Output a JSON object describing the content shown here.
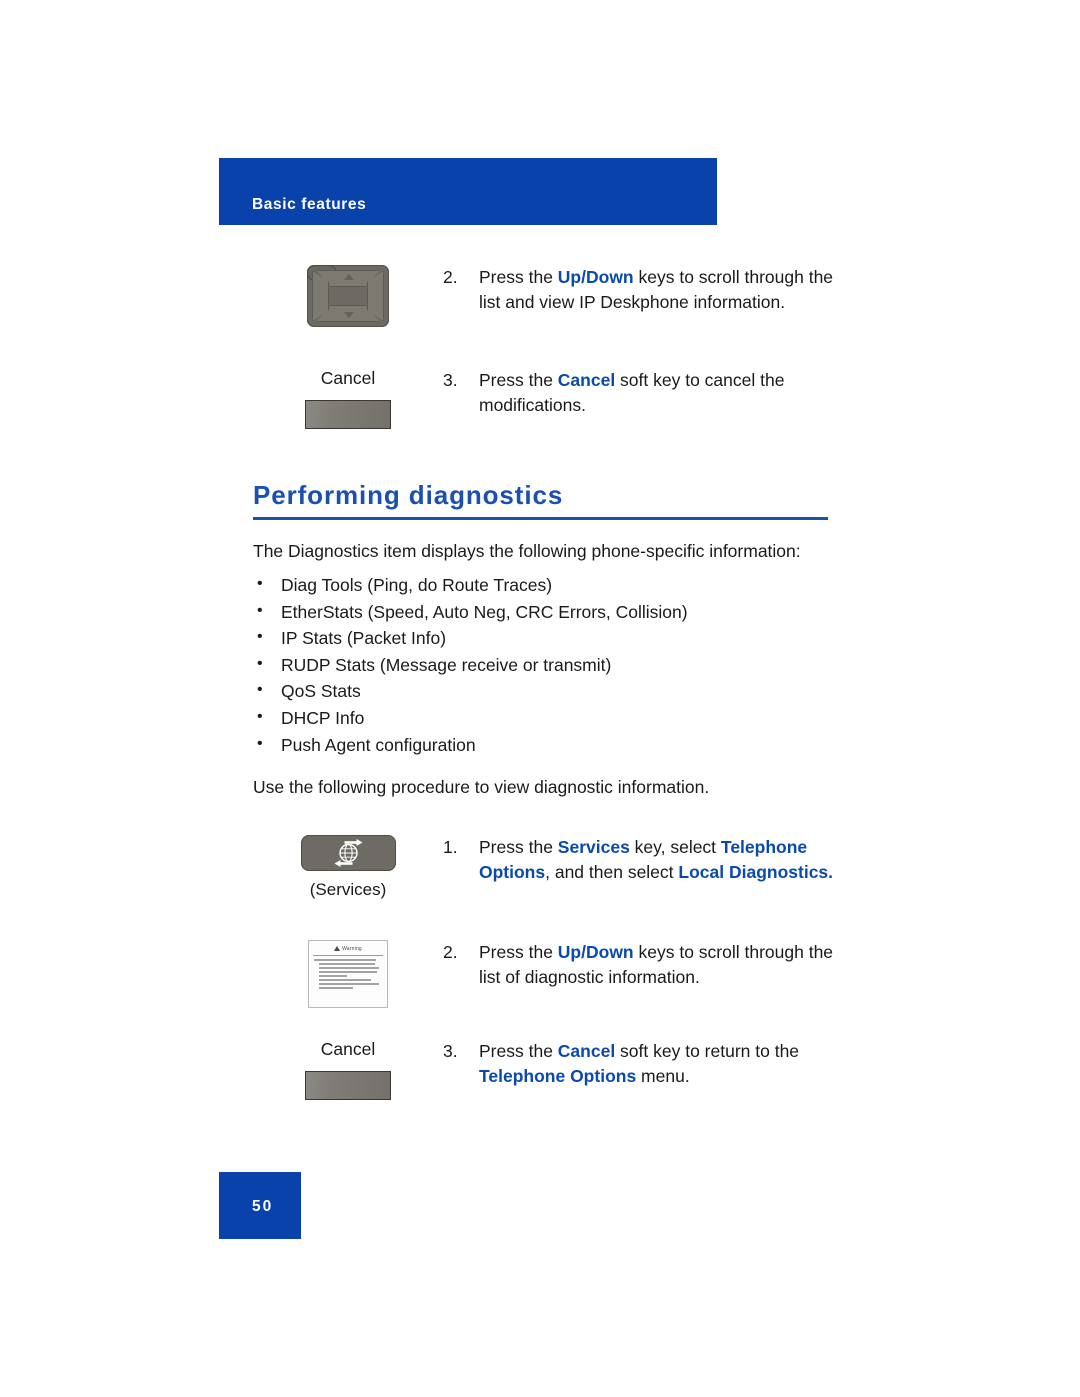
{
  "header": {
    "chapter_title": "Basic features",
    "band_color": "#0A42AC"
  },
  "top_steps": [
    {
      "number": "2.",
      "art": "navigation-cluster-key",
      "text_runs": [
        {
          "t": "Press the ",
          "style": "plain"
        },
        {
          "t": "Up/Down",
          "style": "bold-blue"
        },
        {
          "t": " keys to scroll through the list and view IP Deskphone information.",
          "style": "plain"
        }
      ]
    },
    {
      "number": "3.",
      "art": "cancel-soft-key",
      "art_label": "Cancel",
      "text_runs": [
        {
          "t": "Press the ",
          "style": "plain"
        },
        {
          "t": "Cancel",
          "style": "bold-blue"
        },
        {
          "t": " soft key to cancel the modifications.",
          "style": "plain"
        }
      ]
    }
  ],
  "section": {
    "heading": "Performing diagnostics",
    "heading_color": "#1A50B0",
    "intro": "The Diagnostics item displays the following phone-specific information:",
    "bullets": [
      "Diag Tools (Ping, do Route Traces)",
      "EtherStats (Speed, Auto Neg, CRC Errors, Collision)",
      "IP Stats (Packet Info)",
      "RUDP Stats (Message receive or transmit)",
      "QoS Stats",
      "DHCP Info",
      "Push Agent configuration"
    ],
    "procedure_intro": "Use the following procedure to view diagnostic information."
  },
  "procedure_steps": [
    {
      "number": "1.",
      "art": "services-key",
      "art_label": "(Services)",
      "text_runs": [
        {
          "t": "Press the ",
          "style": "plain"
        },
        {
          "t": "Services",
          "style": "bold-blue"
        },
        {
          "t": " key, select ",
          "style": "plain"
        },
        {
          "t": "Telephone Options",
          "style": "bold-blue"
        },
        {
          "t": ", and then select ",
          "style": "plain"
        },
        {
          "t": "Local Diagnostics.",
          "style": "bold-blue"
        }
      ]
    },
    {
      "number": "2.",
      "art": "screen-thumbnail",
      "screen_thumb": {
        "title": "Warning",
        "icon": "warning-triangle-icon"
      },
      "text_runs": [
        {
          "t": "Press the ",
          "style": "plain"
        },
        {
          "t": "Up/Down",
          "style": "bold-blue"
        },
        {
          "t": " keys to scroll through the list of diagnostic information.",
          "style": "plain"
        }
      ]
    },
    {
      "number": "3.",
      "art": "cancel-soft-key",
      "art_label": "Cancel",
      "text_runs": [
        {
          "t": "Press the ",
          "style": "plain"
        },
        {
          "t": "Cancel",
          "style": "bold-blue"
        },
        {
          "t": " soft key to return to the ",
          "style": "plain"
        },
        {
          "t": "Telephone Options",
          "style": "bold-blue"
        },
        {
          "t": " menu.",
          "style": "plain"
        }
      ]
    }
  ],
  "footer": {
    "page_number": "50",
    "band_color": "#0A42AC"
  }
}
